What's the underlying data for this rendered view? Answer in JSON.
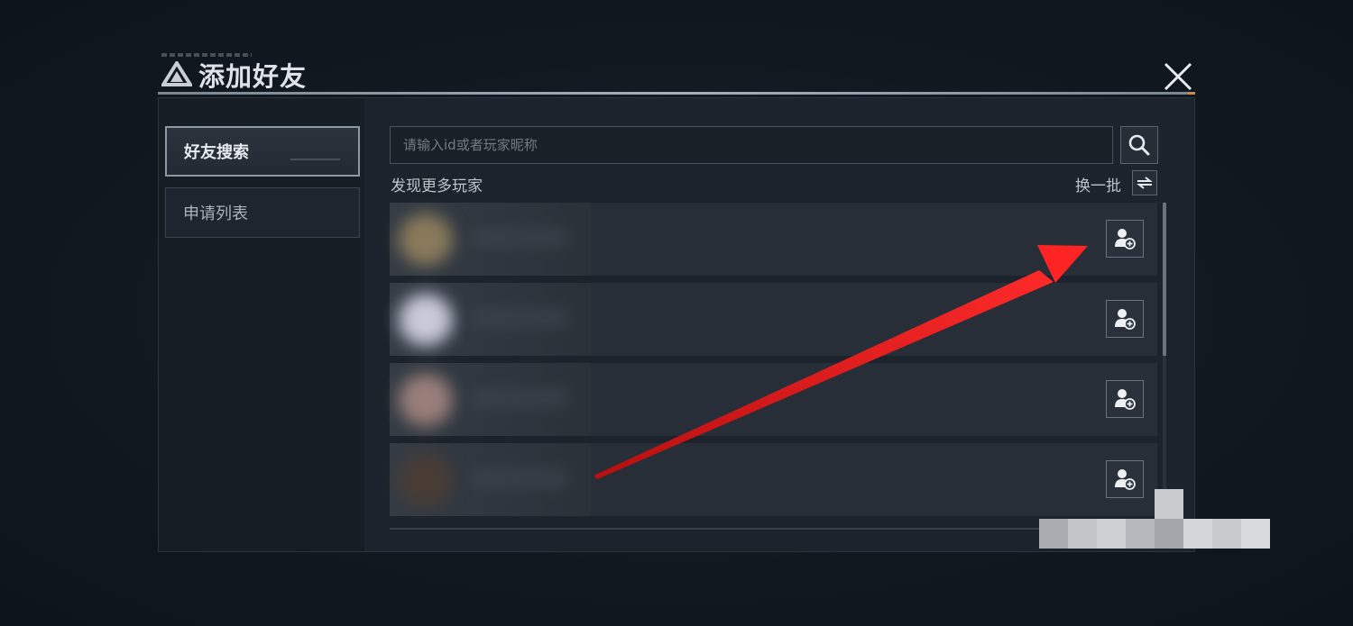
{
  "dialog": {
    "title": "添加好友",
    "close_icon": "close-icon",
    "logo_icon": "triangle-logo-icon"
  },
  "sidebar": {
    "items": [
      {
        "label": "好友搜索",
        "active": true
      },
      {
        "label": "申请列表",
        "active": false
      }
    ]
  },
  "search": {
    "value": "",
    "placeholder": "请输入id或者玩家昵称",
    "button_icon": "search-icon"
  },
  "discover": {
    "label": "发现更多玩家",
    "refresh_label": "换一批",
    "refresh_icon": "swap-arrows-icon"
  },
  "players": [
    {
      "avatar_color": "#8a7a5c",
      "add_icon": "add-friend-icon"
    },
    {
      "avatar_color": "#c9cad9",
      "add_icon": "add-friend-icon"
    },
    {
      "avatar_color": "#9a7f7a",
      "add_icon": "add-friend-icon"
    },
    {
      "avatar_color": "#4a3d35",
      "add_icon": "add-friend-icon"
    }
  ],
  "colors": {
    "accent_arrow": "#e01a1a",
    "panel_bg": "#1c232c",
    "text_primary": "#dfe3e8"
  }
}
